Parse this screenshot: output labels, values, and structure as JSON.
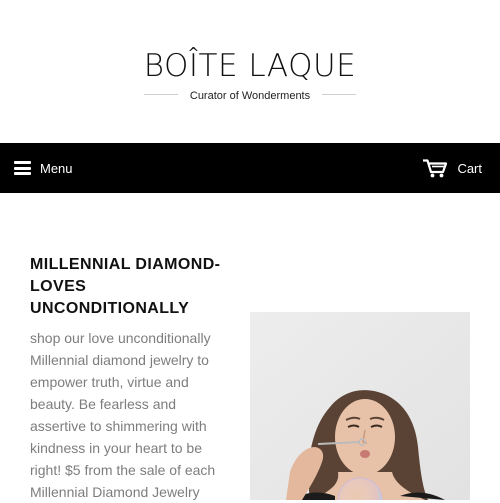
{
  "header": {
    "logo_title": "BOÎTE LAQUE",
    "logo_tagline": "Curator of Wonderments"
  },
  "nav": {
    "menu_label": "Menu",
    "cart_label": "Cart",
    "menu_icon": "hamburger-icon",
    "cart_icon": "cart-icon"
  },
  "product": {
    "title": "MILLENNIAL DIAMOND-LOVES UNCONDITIONALLY",
    "description": "shop our love unconditionally Millennial diamond jewelry to empower truth, virtue and beauty. Be fearless and assertive to shimmering with kindness in your heart to be right! $5 from the sale of each Millennial Diamond Jewelry"
  },
  "colors": {
    "navbar_bg": "#000000",
    "page_bg": "#ffffff",
    "description_text": "#7d7d7d"
  }
}
